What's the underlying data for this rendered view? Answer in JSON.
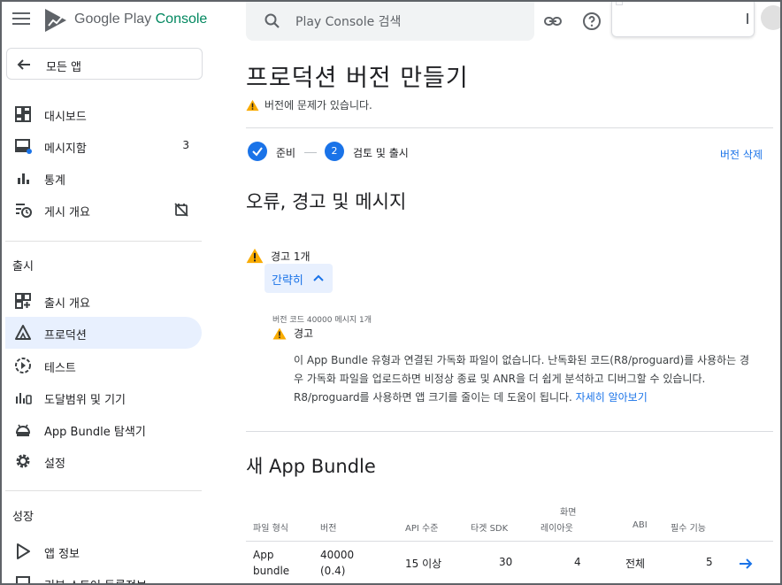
{
  "topbar": {
    "brand_google": "Google Play",
    "brand_console": "Console",
    "search_placeholder": "Play Console 검색"
  },
  "sidebar": {
    "all_apps": "모든 앱",
    "items": [
      {
        "label": "대시보드",
        "icon": "dashboard-icon"
      },
      {
        "label": "메시지함",
        "icon": "inbox-icon",
        "count": "3"
      },
      {
        "label": "통계",
        "icon": "bar-chart-icon"
      },
      {
        "label": "게시 개요",
        "icon": "publishing-overview-icon"
      }
    ],
    "section_release": "출시",
    "release_items": [
      {
        "label": "출시 개요",
        "icon": "release-overview-icon"
      },
      {
        "label": "프로덕션",
        "icon": "production-icon"
      },
      {
        "label": "테스트",
        "icon": "test-icon"
      },
      {
        "label": "도달범위 및 기기",
        "icon": "reach-devices-icon"
      },
      {
        "label": "App Bundle 탐색기",
        "icon": "android-icon"
      },
      {
        "label": "설정",
        "icon": "settings-icon"
      }
    ],
    "section_growth": "성장",
    "growth_items": [
      {
        "label": "앱 정보",
        "icon": "store-presence-icon"
      },
      {
        "label": "기본 스토어 등록정보",
        "icon": "store-listing-icon"
      }
    ]
  },
  "main": {
    "title": "프로덕션 버전 만들기",
    "issue": "버전에 문제가 있습니다.",
    "steps": [
      {
        "label": "준비",
        "done": true
      },
      {
        "num": "2",
        "label": "검토 및 출시"
      }
    ],
    "delete_release": "버전 삭제",
    "errors_heading": "오류, 경고 및 메시지",
    "warning_count": "경고 1개",
    "collapse_label": "간략히",
    "code_line": "버전 코드 40000 메시지 1개",
    "warning_label": "경고",
    "warning_text": "이 App Bundle 유형과 연결된 가독화 파일이 없습니다. 난독화된 코드(R8/proguard)를 사용하는 경우 가독화 파일을 업로드하면 비정상 종료 및 ANR을 더 쉽게 분석하고 디버그할 수 있습니다. R8/proguard를 사용하면 앱 크기를 줄이는 데 도움이 됩니다.",
    "learn_more": "자세히 알아보기",
    "bundle_heading": "새 App Bundle",
    "table": {
      "headers": {
        "file_type": "파일 형식",
        "version": "버전",
        "api_level": "API 수준",
        "target_sdk": "타겟 SDK",
        "screen_layout_1": "화면",
        "screen_layout_2": "레이아웃",
        "abi": "ABI",
        "required_features": "필수 기능"
      },
      "rows": [
        {
          "file_type_1": "App",
          "file_type_2": "bundle",
          "version_1": "40000",
          "version_2": "(0.4)",
          "api_level": "15 이상",
          "target_sdk": "30",
          "screen_layout": "4",
          "abi": "전체",
          "required_features": "5"
        }
      ]
    }
  },
  "colors": {
    "accent": "#1a73e8",
    "brand_green": "#01875f",
    "warning": "#f9ab00",
    "active_nav_bg": "#e8f0fe"
  }
}
